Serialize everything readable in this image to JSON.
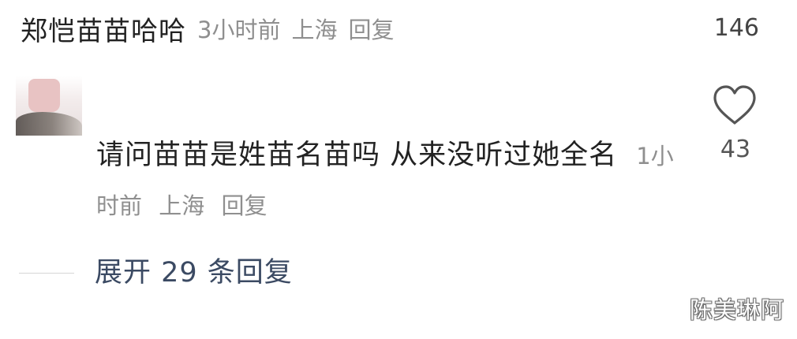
{
  "top_comment": {
    "username": "郑恺苗苗哈哈",
    "time": "3小时前",
    "location": "上海",
    "reply_label": "回复",
    "like_count": "146"
  },
  "comment": {
    "text": "请问苗苗是姓苗名苗吗 从来没听过她全名",
    "time": "1小时前",
    "location": "上海",
    "reply_label": "回复",
    "like_count": "43",
    "like_icon": "heart-outline-icon"
  },
  "expand_replies": {
    "label": "展开 29 条回复"
  },
  "watermark": {
    "text": "陈美琳阿"
  },
  "colors": {
    "primary_text": "#222222",
    "meta_text": "#8f8f8f",
    "expand_text": "#3b4a63"
  }
}
